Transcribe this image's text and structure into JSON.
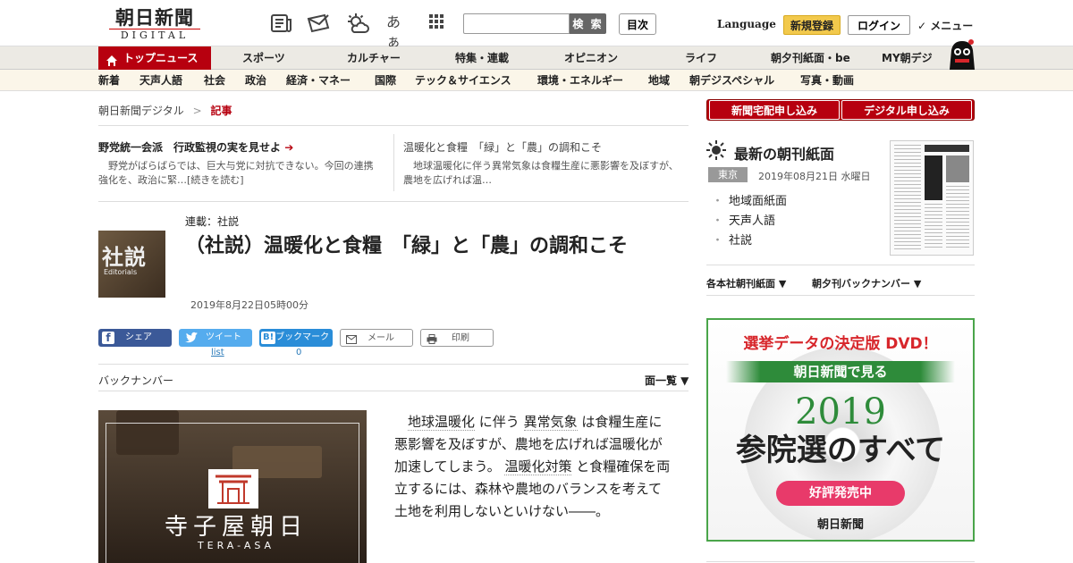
{
  "header": {
    "logo_main": "朝日新聞",
    "logo_sub": "DIGITAL",
    "aa_icon": "あぁ",
    "search_placeholder": "",
    "search_button": "検 索",
    "contents_button": "目次",
    "language": "Language",
    "signup": "新規登録",
    "login": "ログイン",
    "menu": "✓ メニュー"
  },
  "nav_primary": [
    "トップニュース",
    "スポーツ",
    "カルチャー",
    "特集・連載",
    "オピニオン",
    "ライフ",
    "朝夕刊紙面・be",
    "MY朝デジ"
  ],
  "nav_secondary": [
    "新着",
    "天声人語",
    "社会",
    "政治",
    "経済・マネー",
    "国際",
    "テック＆サイエンス",
    "環境・エネルギー",
    "地域",
    "朝デジスペシャル",
    "写真・動画"
  ],
  "breadcrumb": {
    "home": "朝日新聞デジタル",
    "sep": ">",
    "current": "記事"
  },
  "related": [
    {
      "title": "野党統一会派　行政監視の実を見せよ",
      "desc": "野党がばらばらでは、巨大与党に対抗できない。今回の連携強化を、政治に緊…[続きを読む]"
    },
    {
      "title": "温暖化と食糧　「緑」と「農」の調和こそ",
      "desc": "地球温暖化に伴う異常気象は食糧生産に悪影響を及ぼすが、農地を広げれば温…"
    }
  ],
  "article": {
    "thumb_text": "社説",
    "thumb_sub": "Editorials",
    "series": "連載：社説",
    "title": "（社説）温暖化と食糧　「緑」と「農」の調和こそ",
    "date": "2019年8月22日05時00分",
    "share": {
      "facebook": "シェア",
      "twitter": "ツイート",
      "hatena": "ブックマーク",
      "hatena_badge": "B!",
      "mail": "メール",
      "print": "印刷",
      "twitter_count": "list",
      "hatena_count": "0"
    },
    "backnumber": "バックナンバー",
    "list_label": "面一覧 ▼",
    "body_parts": [
      "地球温暖化",
      "に伴う",
      "異常気象",
      "は食糧生産に悪影響を及ぼすが、農地を広げれば温暖化が加速してしまう。",
      "温暖化対策",
      "と食糧確保を両立するには、森林や農地のバランスを考えて土地を利用しないといけない――。"
    ],
    "promo_title": "寺子屋朝日",
    "promo_sub": "TERA-ASA"
  },
  "sidebar": {
    "delivery": "新聞宅配申し込み",
    "digital": "デジタル申し込み",
    "latest_title": "最新の朝刊紙面",
    "region": "東京",
    "paper_date": "2019年08月21日 水曜日",
    "links": [
      "地域面紙面",
      "天声人語",
      "社説"
    ],
    "dropdowns": [
      "各本社朝刊紙面 ▼",
      "朝夕刊バックナンバー ▼"
    ]
  },
  "ad": {
    "headline": "選挙データの決定版 DVD！",
    "banner": "朝日新聞で見る",
    "year": "2019",
    "title": "参院選のすべて",
    "cta": "好評発売中",
    "brand": "朝日新聞",
    "colors": {
      "red": "#d7262b",
      "green": "#2e8b3a",
      "pink": "#e83a6a"
    }
  },
  "colors": {
    "brand_red": "#b7000f",
    "nav_bg": "#eceae4",
    "nav2_bg": "#fbf6e9",
    "signup_yellow": "#f2c94c"
  }
}
